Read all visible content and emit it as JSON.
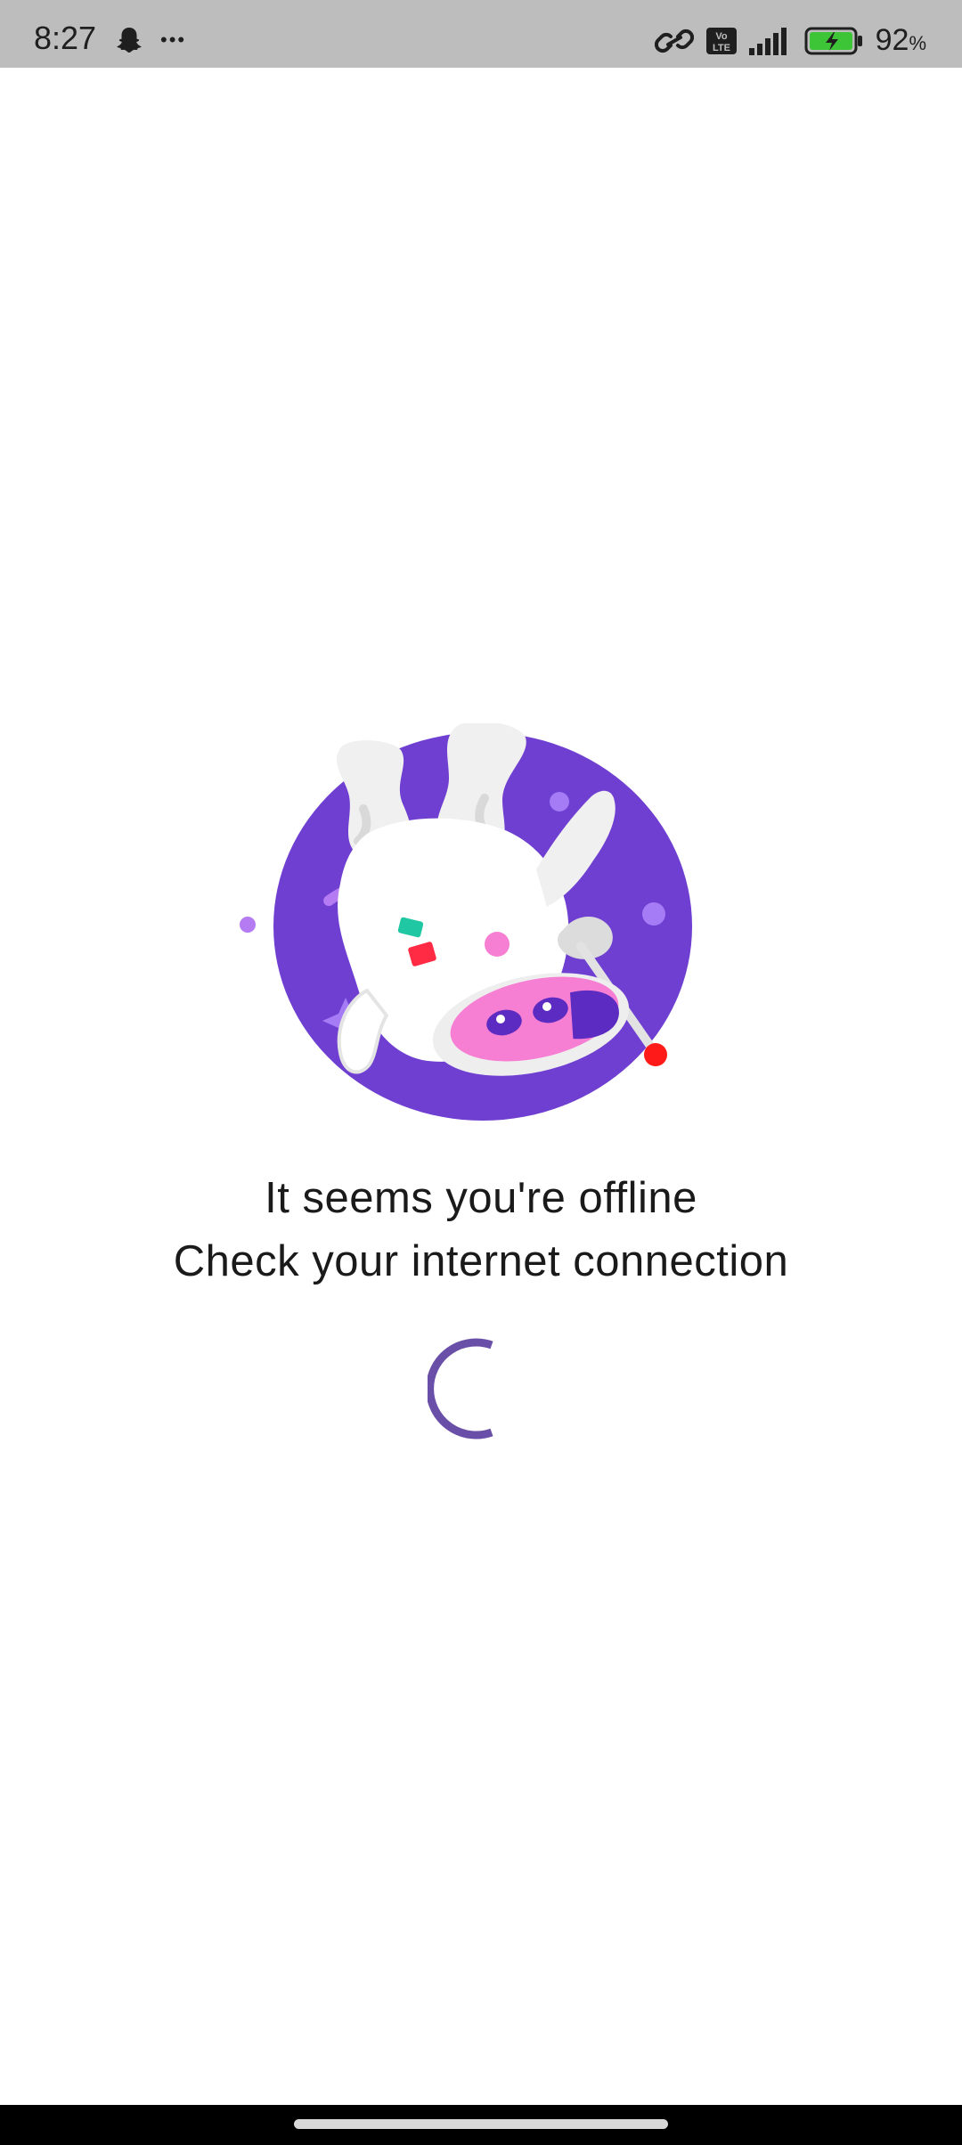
{
  "status_bar": {
    "time": "8:27",
    "overflow_dots": "•••",
    "battery_percent": "92",
    "battery_percent_sign": "%",
    "network_badge_top": "Vo",
    "network_badge_bottom": "LTE",
    "icons": [
      "snapchat-ghost-icon",
      "link-icon",
      "volte-icon",
      "signal-icon",
      "battery-charging-icon"
    ]
  },
  "offline": {
    "illustration": "floating-cow-astronaut",
    "title": "It seems you're offline",
    "subtitle": "Check your internet connection"
  },
  "loader": {
    "state": "loading",
    "color": "#6a4fa8"
  },
  "colors": {
    "status_bar_bg": "#bdbdbd",
    "planet_purple": "#6f3fd1",
    "cow_pink": "#f77fd3",
    "battery_green": "#3ec437"
  }
}
